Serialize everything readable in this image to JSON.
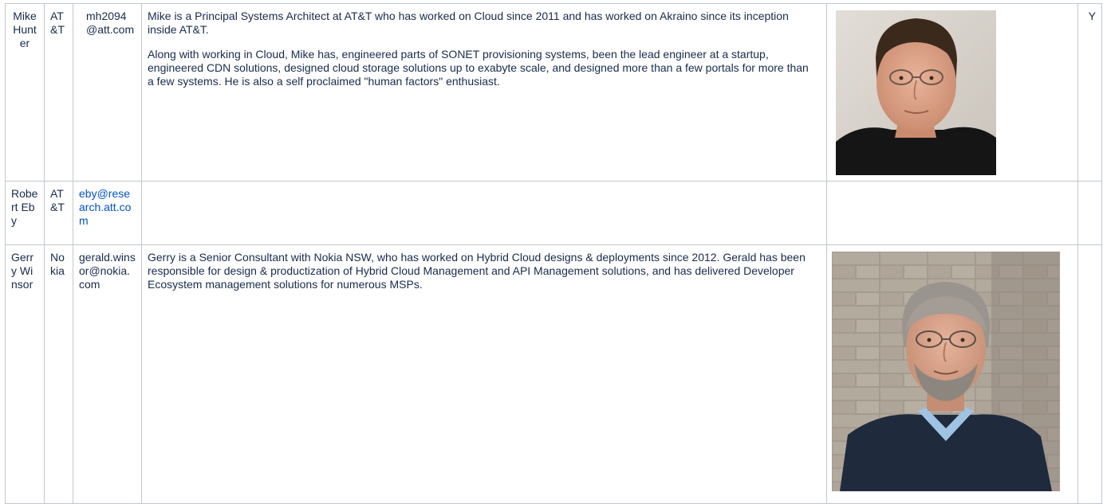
{
  "rows": [
    {
      "name": "Mike Hunter",
      "company": "AT&T",
      "email": "mh2094@att.com",
      "email_is_link": false,
      "bio": [
        " Mike is a Principal Systems Architect at AT&T who has worked on Cloud since 2011 and has worked on Akraino since its inception inside AT&T.",
        "Along with working in Cloud, Mike has, engineered parts of SONET provisioning systems, been the lead engineer at a startup, engineered CDN solutions, designed cloud storage solutions up to exabyte scale, and designed more than a few portals for more than a few systems. He is also a self proclaimed \"human factors\" enthusiast."
      ],
      "photo_icon": "portrait-photo",
      "flag": "Y"
    },
    {
      "name": "Robert Eby",
      "company": "AT&T",
      "email": "eby@research.att.com",
      "email_is_link": true,
      "bio": [],
      "photo_icon": "",
      "flag": ""
    },
    {
      "name": "Gerry Winsor",
      "company": "Nokia",
      "email": "gerald.winsor@nokia.com",
      "email_is_link": false,
      "bio": [
        "Gerry is a Senior Consultant with Nokia NSW, who has worked on Hybrid Cloud designs & deployments since 2012. Gerald has been responsible for design & productization of Hybrid Cloud Management and API Management solutions, and has delivered Developer Ecosystem management solutions for numerous MSPs."
      ],
      "photo_icon": "portrait-photo",
      "flag": ""
    }
  ],
  "colors": {
    "border": "#c1c7d0",
    "text": "#172b4d",
    "link": "#0052cc"
  }
}
